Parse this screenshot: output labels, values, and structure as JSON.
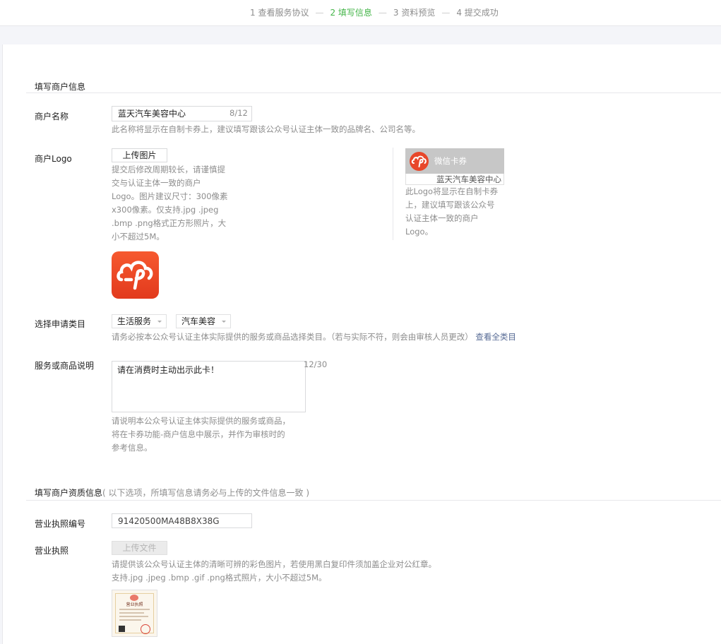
{
  "steps": [
    {
      "label": "1 查看服务协议"
    },
    {
      "label": "2 填写信息"
    },
    {
      "label": "3 资料预览"
    },
    {
      "label": "4 提交成功"
    }
  ],
  "step_separator": "—",
  "colors": {
    "accent": "#44b549",
    "link": "#576b95",
    "muted": "#8d8d8d",
    "logo": "#ec4a27"
  },
  "merchant_section": {
    "title": "填写商户信息",
    "name_label": "商户名称",
    "name_value": "蓝天汽车美容中心",
    "name_counter": "8/12",
    "name_tip": "此名称将显示在自制卡券上，建议填写跟该公众号认证主体一致的品牌名、公司名等。",
    "logo_label": "商户Logo",
    "upload_image_button": "上传图片",
    "logo_tip_lines": [
      "提交后修改周期较长，请谨慎提",
      "交与认证主体一致的商户",
      "Logo。图片建议尺寸：300像素",
      "x300像素。仅支持.jpg .jpeg",
      ".bmp .png格式正方形照片，大",
      "小不超过5M。"
    ],
    "logo_icon": "cloud-p-logo-icon",
    "preview": {
      "card_title": "微信卡券",
      "merchant_name": "蓝天汽车美容中心",
      "tip_lines": [
        "此Logo将显示在自制卡券",
        "上，建议填写跟该公众号",
        "认证主体一致的商户",
        "Logo。"
      ]
    },
    "category_label": "选择申请类目",
    "category_primary": "生活服务",
    "category_secondary": "汽车美容",
    "category_tip": "请务必按本公众号认证主体实际提供的服务或商品选择类目。（若与实际不符，则会由审核人员更改）",
    "category_link": "查看全类目",
    "desc_label": "服务或商品说明",
    "desc_value": "请在消费时主动出示此卡！",
    "desc_counter": "12/30",
    "desc_tip_lines": [
      "请说明本公众号认证主体实际提供的服务或商品，",
      "将在卡券功能-商户信息中展示，并作为审核时的",
      "参考信息。"
    ]
  },
  "qualification_section": {
    "title": "填写商户资质信息",
    "subtitle": "( 以下选项，所填写信息请务必与上传的文件信息一致 )",
    "license_no_label": "营业执照编号",
    "license_no_value": "91420500MA48B8X38G",
    "license_label": "营业执照",
    "upload_file_button": "上传文件",
    "license_tip_lines": [
      "请提供该公众号认证主体的清晰可辨的彩色图片，若使用黑白复印件须加盖企业对公红章。",
      "支持.jpg .jpeg .bmp .gif .png格式照片，大小不超过5M。"
    ],
    "license_thumb_title": "营业执照"
  }
}
